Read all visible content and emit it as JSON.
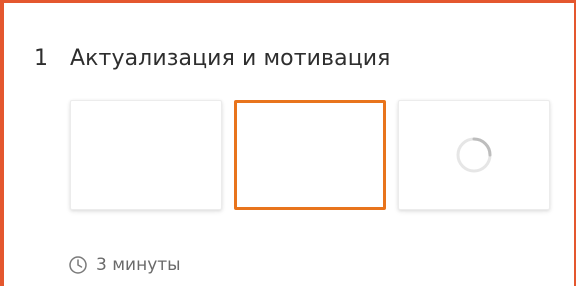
{
  "activity": {
    "number": "1",
    "title": "Актуализация и мотивация",
    "duration": "3 минуты"
  },
  "cards": [
    {
      "state": "empty"
    },
    {
      "state": "selected"
    },
    {
      "state": "loading",
      "icon": "spinner-icon"
    }
  ],
  "colors": {
    "frame_edge": "#e4572e",
    "selected_border": "#e8741c",
    "title_text": "#2e2e2e",
    "meta_text": "#6a6a6a"
  }
}
